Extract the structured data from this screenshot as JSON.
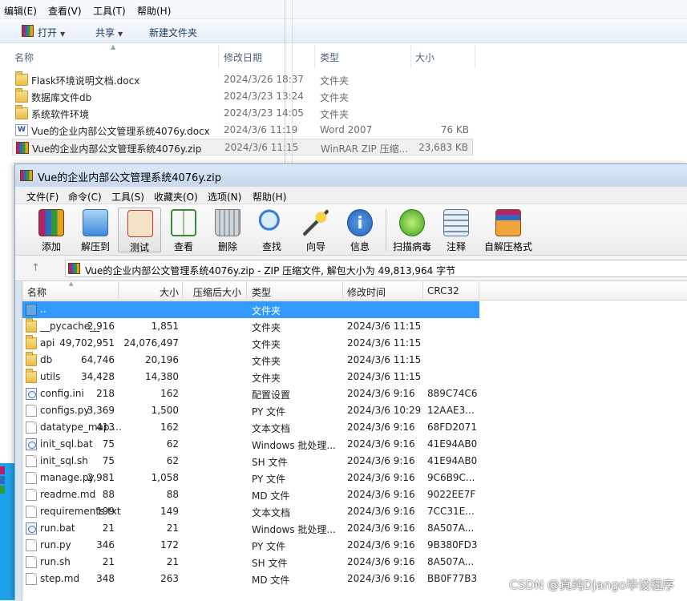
{
  "explorer": {
    "menu": [
      "编辑(E)",
      "查看(V)",
      "工具(T)",
      "帮助(H)"
    ],
    "toolbar": {
      "open": "打开",
      "share": "共享",
      "new_folder": "新建文件夹"
    },
    "columns": {
      "name": "名称",
      "date": "修改日期",
      "type": "类型",
      "size": "大小"
    },
    "files": [
      {
        "name": "Flask环境说明文档.docx",
        "date": "2024/3/26 18:37",
        "type": "文件夹",
        "size": "",
        "icon": "folder-icon"
      },
      {
        "name": "数据库文件db",
        "date": "2024/3/23 13:24",
        "type": "文件夹",
        "size": "",
        "icon": "folder-icon"
      },
      {
        "name": "系统软件环境",
        "date": "2024/3/23 14:05",
        "type": "文件夹",
        "size": "",
        "icon": "folder-icon"
      },
      {
        "name": "Vue的企业内部公文管理系统4076y.docx",
        "date": "2024/3/6 11:19",
        "type": "Word 2007",
        "size": "76 KB",
        "icon": "word-doc-icon"
      },
      {
        "name": "Vue的企业内部公文管理系统4076y.zip",
        "date": "2024/3/6 11:15",
        "type": "WinRAR ZIP 压缩...",
        "size": "23,683 KB",
        "icon": "winrar-archive-icon",
        "selected": true
      }
    ]
  },
  "winrar": {
    "title": "Vue的企业内部公文管理系统4076y.zip",
    "menu": [
      "文件(F)",
      "命令(C)",
      "工具(S)",
      "收藏夹(O)",
      "选项(N)",
      "帮助(H)"
    ],
    "tools": [
      "添加",
      "解压到",
      "测试",
      "查看",
      "删除",
      "查找",
      "向导",
      "信息",
      "扫描病毒",
      "注释",
      "自解压格式"
    ],
    "path_text": "Vue的企业内部公文管理系统4076y.zip - ZIP 压缩文件, 解包大小为 49,813,964 字节",
    "columns": {
      "name": "名称",
      "size": "大小",
      "packed": "压缩后大小",
      "type": "类型",
      "modified": "修改时间",
      "crc": "CRC32"
    },
    "rows": [
      {
        "name": "..",
        "size": "",
        "packed": "",
        "type": "文件夹",
        "modified": "",
        "crc": "",
        "icon": "parent-folder-icon",
        "selected": true
      },
      {
        "name": "__pycache__",
        "size": "2,916",
        "packed": "1,851",
        "type": "文件夹",
        "modified": "2024/3/6 11:15",
        "crc": "",
        "icon": "folder-icon"
      },
      {
        "name": "api",
        "size": "49,702,951",
        "packed": "24,076,497",
        "type": "文件夹",
        "modified": "2024/3/6 11:15",
        "crc": "",
        "icon": "folder-icon"
      },
      {
        "name": "db",
        "size": "64,746",
        "packed": "20,196",
        "type": "文件夹",
        "modified": "2024/3/6 11:15",
        "crc": "",
        "icon": "folder-icon"
      },
      {
        "name": "utils",
        "size": "34,428",
        "packed": "14,380",
        "type": "文件夹",
        "modified": "2024/3/6 11:15",
        "crc": "",
        "icon": "folder-icon"
      },
      {
        "name": "config.ini",
        "size": "218",
        "packed": "162",
        "type": "配置设置",
        "modified": "2024/3/6 9:16",
        "crc": "889C74C6",
        "icon": "settings-file-icon"
      },
      {
        "name": "configs.py",
        "size": "3,369",
        "packed": "1,500",
        "type": "PY 文件",
        "modified": "2024/3/6 10:29",
        "crc": "12AAE3...",
        "icon": "file-icon"
      },
      {
        "name": "datatype_map....",
        "size": "413",
        "packed": "162",
        "type": "文本文档",
        "modified": "2024/3/6 9:16",
        "crc": "68FD2071",
        "icon": "file-icon"
      },
      {
        "name": "init_sql.bat",
        "size": "75",
        "packed": "62",
        "type": "Windows 批处理...",
        "modified": "2024/3/6 9:16",
        "crc": "41E94AB0",
        "icon": "batch-file-icon"
      },
      {
        "name": "init_sql.sh",
        "size": "75",
        "packed": "62",
        "type": "SH 文件",
        "modified": "2024/3/6 9:16",
        "crc": "41E94AB0",
        "icon": "file-icon"
      },
      {
        "name": "manage.py",
        "size": "2,981",
        "packed": "1,058",
        "type": "PY 文件",
        "modified": "2024/3/6 9:16",
        "crc": "9C6B9C...",
        "icon": "file-icon"
      },
      {
        "name": "readme.md",
        "size": "88",
        "packed": "88",
        "type": "MD 文件",
        "modified": "2024/3/6 9:16",
        "crc": "9022EE7F",
        "icon": "file-icon"
      },
      {
        "name": "requirements.txt",
        "size": "199",
        "packed": "149",
        "type": "文本文档",
        "modified": "2024/3/6 9:16",
        "crc": "7CC31E...",
        "icon": "file-icon"
      },
      {
        "name": "run.bat",
        "size": "21",
        "packed": "21",
        "type": "Windows 批处理...",
        "modified": "2024/3/6 9:16",
        "crc": "8A507A...",
        "icon": "batch-file-icon"
      },
      {
        "name": "run.py",
        "size": "346",
        "packed": "172",
        "type": "PY 文件",
        "modified": "2024/3/6 9:16",
        "crc": "9B380FD3",
        "icon": "file-icon"
      },
      {
        "name": "run.sh",
        "size": "21",
        "packed": "21",
        "type": "SH 文件",
        "modified": "2024/3/6 9:16",
        "crc": "8A507A...",
        "icon": "file-icon"
      },
      {
        "name": "step.md",
        "size": "348",
        "packed": "263",
        "type": "MD 文件",
        "modified": "2024/3/6 9:16",
        "crc": "BB0F77B3",
        "icon": "file-icon"
      }
    ]
  },
  "watermark": "CSDN @真纯Django毕设程序",
  "colors": {
    "selection": "#3399ff",
    "window_frame": "#d7e4f2"
  }
}
